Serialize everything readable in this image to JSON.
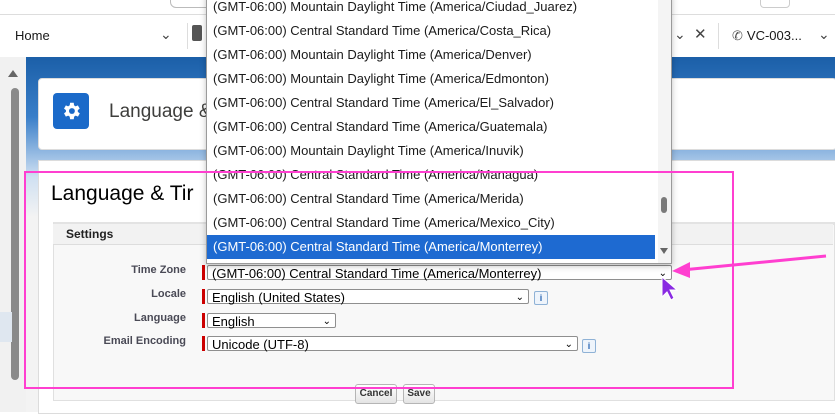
{
  "tabs": {
    "home_label": "Home",
    "vc_label": "VC-003..."
  },
  "header": {
    "title": "Language &"
  },
  "page": {
    "heading": "Language & Tir"
  },
  "settings": {
    "section_label": "Settings",
    "fields": {
      "time_zone": {
        "label": "Time Zone",
        "value": "(GMT-06:00) Central Standard Time (America/Monterrey)"
      },
      "locale": {
        "label": "Locale",
        "value": "English (United States)"
      },
      "language": {
        "label": "Language",
        "value": "English"
      },
      "email_encoding": {
        "label": "Email Encoding",
        "value": "Unicode (UTF-8)"
      }
    },
    "info_glyph": "i",
    "cancel_label": "Cancel",
    "save_label": "Save"
  },
  "dropdown": {
    "options": [
      "(GMT-06:00) Mountain Daylight Time (America/Ciudad_Juarez)",
      "(GMT-06:00) Central Standard Time (America/Costa_Rica)",
      "(GMT-06:00) Mountain Daylight Time (America/Denver)",
      "(GMT-06:00) Mountain Daylight Time (America/Edmonton)",
      "(GMT-06:00) Central Standard Time (America/El_Salvador)",
      "(GMT-06:00) Central Standard Time (America/Guatemala)",
      "(GMT-06:00) Mountain Daylight Time (America/Inuvik)",
      "(GMT-06:00) Central Standard Time (America/Managua)",
      "(GMT-06:00) Central Standard Time (America/Merida)",
      "(GMT-06:00) Central Standard Time (America/Mexico_City)",
      "(GMT-06:00) Central Standard Time (America/Monterrey)"
    ],
    "selected_option": "(GMT-06:00) Central Standard Time (America/Monterrey)"
  },
  "colors": {
    "accent": "#1e6ad1",
    "annotation": "#ff3fd0",
    "required": "#c00000"
  }
}
